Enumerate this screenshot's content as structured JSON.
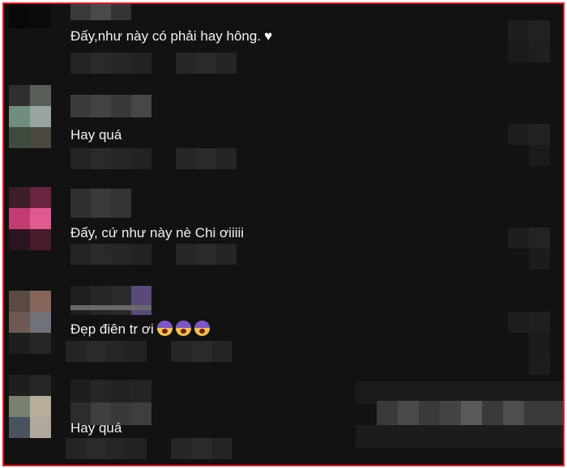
{
  "comments": [
    {
      "text": "Đấy,như này có phải hay hông.",
      "suffix_icon": "white-heart-icon"
    },
    {
      "text": "Hay quá"
    },
    {
      "text": "Đấy, cứ như này nè Chi ơiiiii"
    },
    {
      "text": "Đẹp điên tr ơi",
      "suffix_icon": "screaming-face-icon x3"
    },
    {
      "text": "Hay quá"
    }
  ],
  "colors": {
    "frame_border": "#e01b22",
    "background": "#121212",
    "text": "#f1f1f1"
  }
}
